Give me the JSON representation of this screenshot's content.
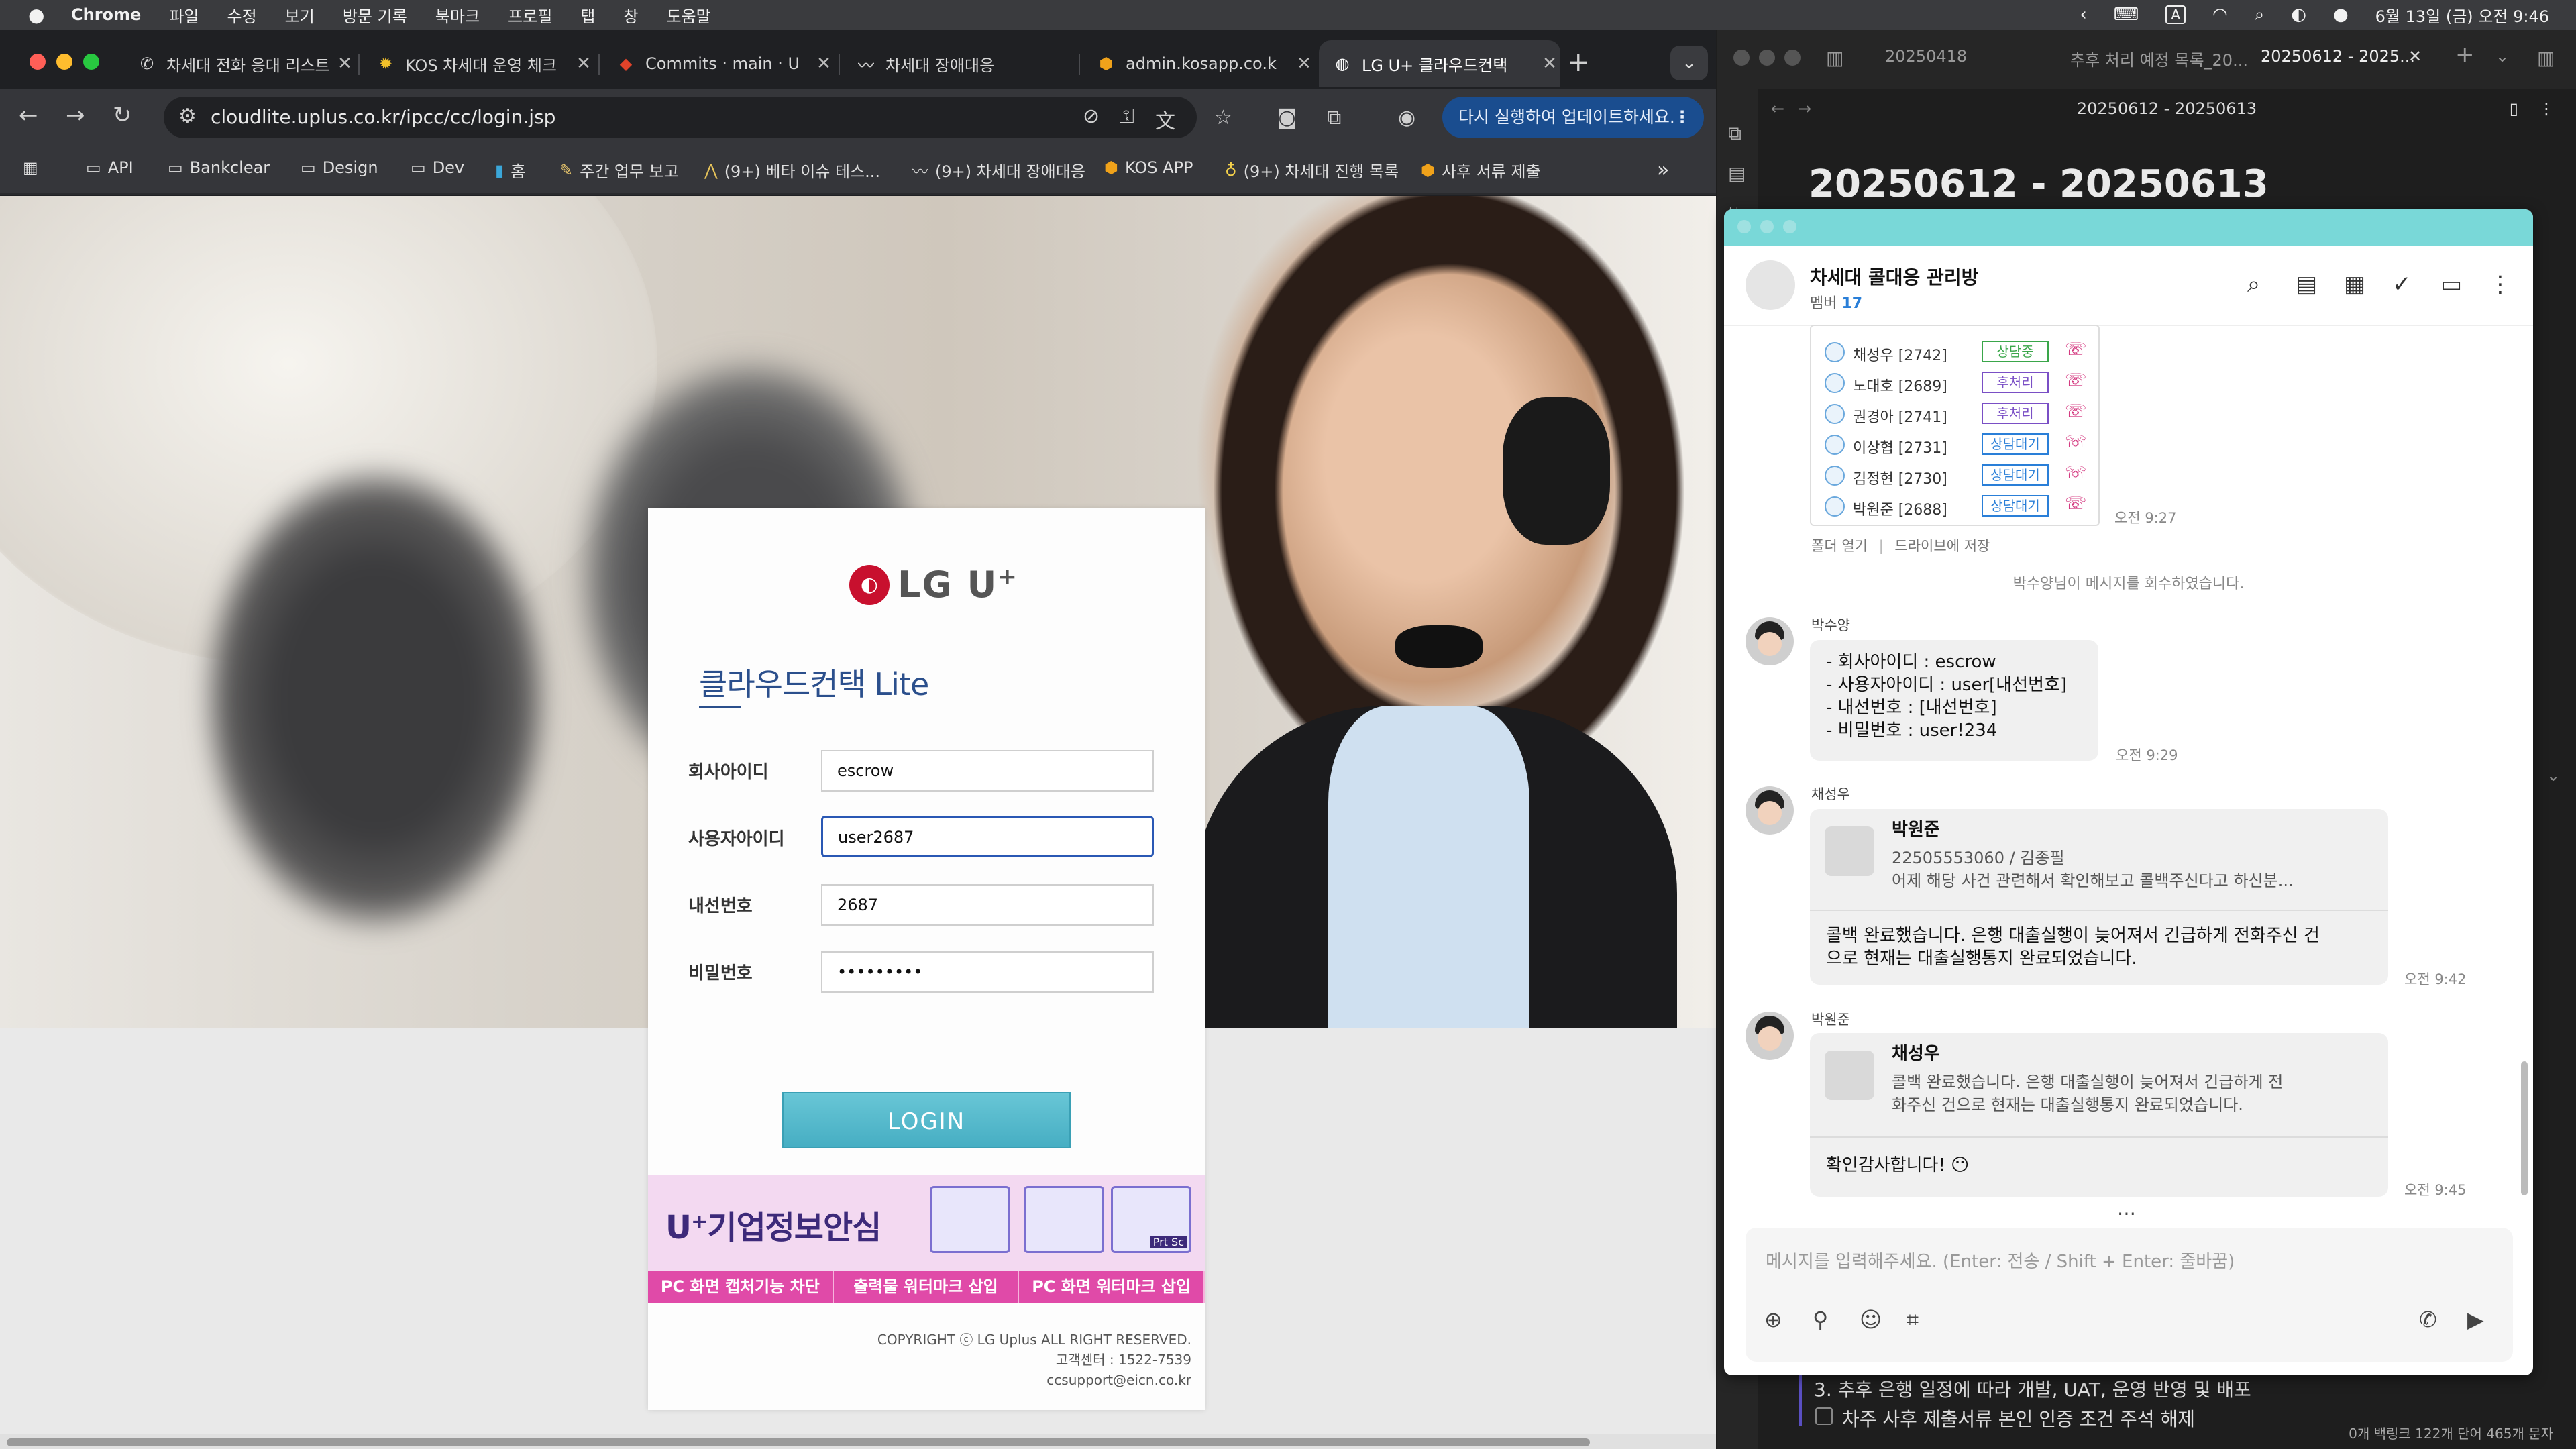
{
  "menubar": {
    "app": "Chrome",
    "items": [
      "파일",
      "수정",
      "보기",
      "방문 기록",
      "북마크",
      "프로필",
      "탭",
      "창",
      "도움말"
    ],
    "datetime": "6월 13일 (금) 오전 9:46",
    "input_indicator": "A"
  },
  "chrome": {
    "tabs": [
      {
        "title": "차세대 전화 응대 리스트",
        "icon": "phone-icon"
      },
      {
        "title": "KOS 차세대 운영 체크",
        "icon": "sun-icon"
      },
      {
        "title": "Commits · main · U",
        "icon": "gitlab-icon"
      },
      {
        "title": "차세대 장애대응",
        "icon": "swoosh-icon"
      },
      {
        "title": "admin.kosapp.co.k",
        "icon": "kos-icon"
      },
      {
        "title": "LG U+ 클라우드컨택",
        "icon": "globe-icon",
        "active": true
      }
    ],
    "url": "cloudlite.uplus.co.kr/ipcc/cc/login.jsp",
    "update_button": "다시 실행하여 업데이트하세요.",
    "bookmarks": [
      {
        "label": "API",
        "icon": "folder-icon"
      },
      {
        "label": "Bankclear",
        "icon": "folder-icon"
      },
      {
        "label": "Design",
        "icon": "folder-icon"
      },
      {
        "label": "Dev",
        "icon": "folder-icon"
      },
      {
        "label": "홈",
        "icon": "board-icon"
      },
      {
        "label": "주간 업무 보고",
        "icon": "doc-icon"
      },
      {
        "label": "(9+) 베타 이슈 테스...",
        "icon": "person-icon"
      },
      {
        "label": "(9+) 차세대 장애대응",
        "icon": "swoosh-icon"
      },
      {
        "label": "KOS APP",
        "icon": "kos-icon"
      },
      {
        "label": "(9+) 차세대 진행 목록",
        "icon": "bulb-icon"
      },
      {
        "label": "사후 서류 제출",
        "icon": "kos-icon"
      }
    ]
  },
  "login": {
    "brand": "LG U",
    "brand_sup": "+",
    "product": "클라우드컨택 Lite",
    "fields": [
      {
        "label": "회사아이디",
        "value": "escrow"
      },
      {
        "label": "사용자아이디",
        "value": "user2687"
      },
      {
        "label": "내선번호",
        "value": "2687"
      },
      {
        "label": "비밀번호",
        "value": "•••••••••"
      }
    ],
    "button": "LOGIN",
    "banner": {
      "title": "U⁺기업정보안심",
      "items": [
        "PC 화면 캡처기능 차단",
        "출력물 워터마크 삽입",
        "PC 화면 워터마크 삽입"
      ],
      "mock_label": "Prt Sc"
    },
    "copyright": [
      "COPYRIGHT ⓒ LG Uplus ALL RIGHT RESERVED.",
      "고객센터 : 1522-7539",
      "ccsupport@eicn.co.kr"
    ]
  },
  "notes": {
    "tabs": [
      "20250418",
      "추후 처리 예정 목록_20...",
      "20250612 - 2025..."
    ],
    "window_title": "20250612 - 20250613",
    "heading": "20250612 - 20250613",
    "bottom_lines": [
      "3. 추후 은행 일정에 따라 개발, UAT, 운영 반영 및 배포",
      "차주 사후 제출서류 본인 인증 조건 주석 해제"
    ],
    "status": "0개 백링크   122개 단어   465개 문자"
  },
  "chat": {
    "room_name": "차세대 콜대응 관리방",
    "members_label": "멤버",
    "members_count": "17",
    "presence": [
      {
        "name": "채성우 [2742]",
        "status": "상담중",
        "color": "#3aa64a"
      },
      {
        "name": "노대호 [2689]",
        "status": "후처리",
        "color": "#7a4fc5"
      },
      {
        "name": "권경아 [2741]",
        "status": "후처리",
        "color": "#7a4fc5"
      },
      {
        "name": "이상협 [2731]",
        "status": "상담대기",
        "color": "#2a7fd8"
      },
      {
        "name": "김정현 [2730]",
        "status": "상담대기",
        "color": "#2a7fd8"
      },
      {
        "name": "박원준 [2688]",
        "status": "상담대기",
        "color": "#2a7fd8"
      }
    ],
    "image_time": "오전 9:27",
    "image_actions": [
      "폴더 열기",
      "드라이브에 저장"
    ],
    "system_msg": "박수양님이 메시지를 회수하였습니다.",
    "messages": [
      {
        "sender": "박수양",
        "lines": [
          "- 회사아이디 : escrow",
          "- 사용자아이디 : user[내선번호]",
          "- 내선번호 : [내선번호]",
          "- 비밀번호 : user!234"
        ],
        "time": "오전 9:29"
      },
      {
        "sender": "채성우",
        "quote_name": "박원준",
        "quote_lines": [
          "22505553060 / 김종필",
          "어제 해당 사건 관련해서 확인해보고 콜백주신다고 하신분..."
        ],
        "lines": [
          "콜백 완료했습니다. 은행 대출실행이 늦어져서 긴급하게 전화주신 건",
          "으로 현재는 대출실행통지 완료되었습니다."
        ],
        "time": "오전 9:42"
      },
      {
        "sender": "박원준",
        "quote_name": "채성우",
        "quote_lines": [
          "콜백 완료했습니다. 은행 대출실행이 늦어져서 긴급하게 전",
          "화주신 건으로 현재는 대출실행통지 완료되었습니다."
        ],
        "lines": [
          "확인감사합니다! 😶"
        ],
        "time": "오전 9:45"
      }
    ],
    "composer_placeholder": "메시지를 입력해주세요. (Enter: 전송 / Shift + Enter: 줄바꿈)"
  }
}
